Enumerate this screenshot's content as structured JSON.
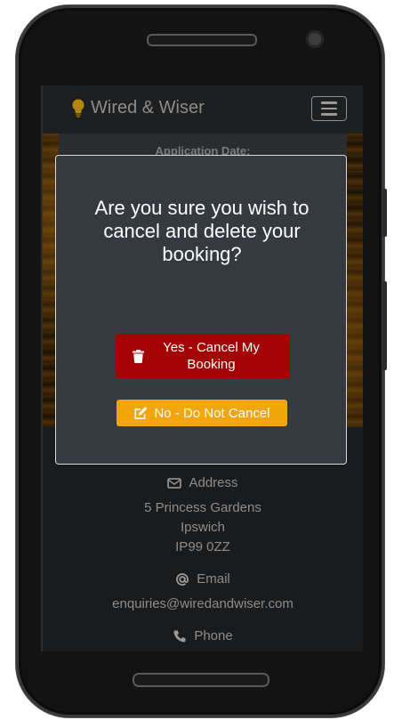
{
  "navbar": {
    "brand": "Wired & Wiser",
    "icons": {
      "brand": "lightbulb-icon",
      "menu": "hamburger-menu-icon"
    }
  },
  "background": {
    "application_date_label": "Application Date:"
  },
  "contact": {
    "address_label": "Address",
    "address_line1": "5 Princess Gardens",
    "address_line2": "Ipswich",
    "address_line3": "IP99 0ZZ",
    "email_label": "Email",
    "email_value": "enquiries@wiredandwiser.com",
    "phone_label": "Phone",
    "icons": {
      "address": "envelope-icon",
      "email": "at-sign-icon",
      "phone": "phone-icon"
    }
  },
  "modal": {
    "question": "Are you sure you wish to cancel and delete your booking?",
    "confirm_label": "Yes - Cancel My Booking",
    "cancel_label": "No - Do Not Cancel",
    "icons": {
      "confirm": "trash-icon",
      "cancel": "edit-icon"
    },
    "colors": {
      "confirm": "#a30303",
      "cancel": "#f2a60c",
      "panel": "#343a40"
    }
  }
}
